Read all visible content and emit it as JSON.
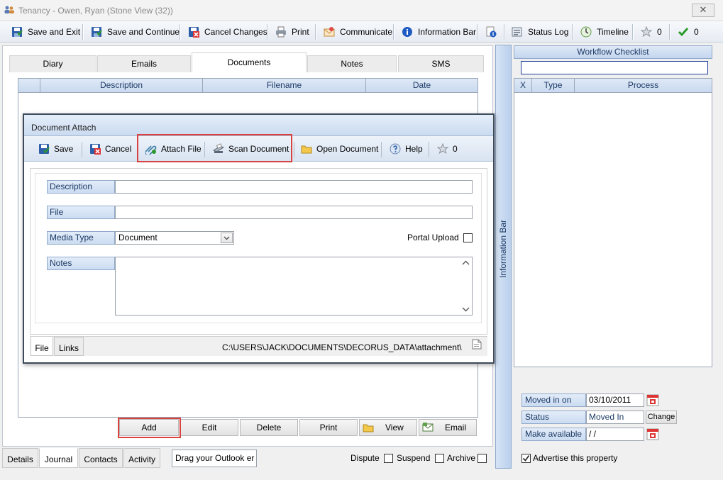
{
  "window": {
    "title": "Tenancy - Owen, Ryan (Stone View (32))",
    "close_glyph": "✕"
  },
  "toolbar": {
    "save_exit": "Save and Exit",
    "save_continue": "Save and Continue",
    "cancel_changes": "Cancel Changes",
    "print": "Print",
    "communicate": "Communicate",
    "information_bar": "Information Bar",
    "status_log": "Status Log",
    "timeline": "Timeline",
    "star_count": "0",
    "check_count": "0"
  },
  "main_tabs": [
    "Diary",
    "Emails",
    "Documents",
    "Notes",
    "SMS"
  ],
  "active_main_tab": "Documents",
  "documents_grid": {
    "columns": [
      "Description",
      "Filename",
      "Date"
    ],
    "rows": []
  },
  "action_buttons": {
    "add": "Add",
    "edit": "Edit",
    "delete": "Delete",
    "print": "Print",
    "view": "View",
    "email": "Email"
  },
  "bottom_tabs": [
    "Details",
    "Journal",
    "Contacts",
    "Activity"
  ],
  "active_bottom_tab": "Journal",
  "drag_outlook": "Drag your Outlook er",
  "flags": {
    "dispute": "Dispute",
    "suspend": "Suspend",
    "archive": "Archive"
  },
  "information_bar_label": "Information Bar",
  "workflow": {
    "title": "Workflow Checklist",
    "columns": [
      "X",
      "Type",
      "Process"
    ],
    "search_value": ""
  },
  "property": {
    "moved_in_on_label": "Moved in on",
    "moved_in_on_value": "03/10/2011",
    "status_label": "Status",
    "status_value": "Moved In",
    "change_button": "Change",
    "make_available_label": "Make available",
    "make_available_value": " / /",
    "advertise_label": "Advertise this property",
    "advertise_checked": true
  },
  "dialog": {
    "title": "Document Attach",
    "toolbar": {
      "save": "Save",
      "cancel": "Cancel",
      "attach_file": "Attach File",
      "scan_document": "Scan Document",
      "open_document": "Open Document",
      "help": "Help",
      "star_count": "0"
    },
    "fields": {
      "description_label": "Description",
      "description_value": "",
      "file_label": "File",
      "file_value": "",
      "media_type_label": "Media Type",
      "media_type_value": "Document",
      "portal_upload_label": "Portal Upload",
      "notes_label": "Notes",
      "notes_value": ""
    },
    "footer_tabs": [
      "File",
      "Links"
    ],
    "active_footer_tab": "File",
    "path": "C:\\USERS\\JACK\\DOCUMENTS\\DECORUS_DATA\\attachment\\"
  },
  "colors": {
    "highlight": "#d9423e",
    "header_blue": "#1d3a66",
    "accent": "#90a9cc"
  }
}
